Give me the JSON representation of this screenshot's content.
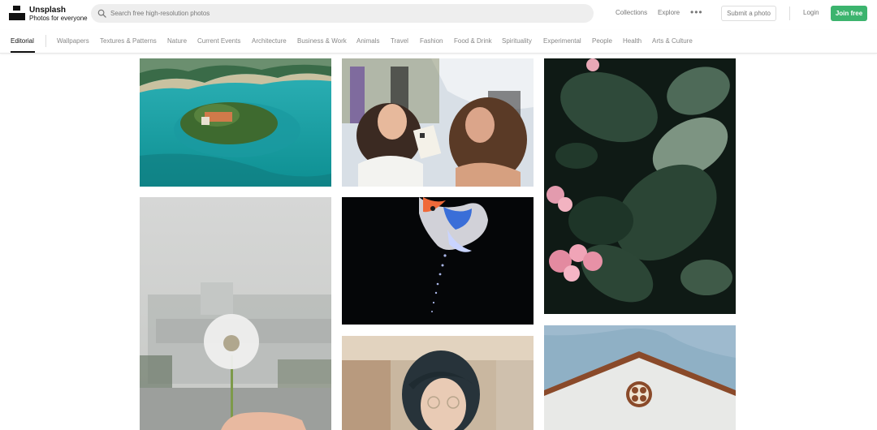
{
  "brand": {
    "name": "Unsplash",
    "tagline": "Photos for everyone"
  },
  "search": {
    "placeholder": "Search free high-resolution photos",
    "value": ""
  },
  "nav": {
    "collections": "Collections",
    "explore": "Explore",
    "more": "•••",
    "submit": "Submit a photo",
    "login": "Login",
    "join": "Join free"
  },
  "categories": [
    "Editorial",
    "Wallpapers",
    "Textures & Patterns",
    "Nature",
    "Current Events",
    "Architecture",
    "Business & Work",
    "Animals",
    "Travel",
    "Fashion",
    "Food & Drink",
    "Spirituality",
    "Experimental",
    "People",
    "Health",
    "Arts & Culture"
  ],
  "active_category": "Editorial",
  "colors": {
    "accent": "#3cb46e",
    "text": "#111111",
    "muted": "#777777"
  },
  "photos": [
    {
      "subject": "island in turquoise lake"
    },
    {
      "subject": "two women laughing at festival"
    },
    {
      "subject": "dark leaves with pink flowers"
    },
    {
      "subject": "hand holding dandelion"
    },
    {
      "subject": "colorful betta fish on black"
    },
    {
      "subject": "woman with short dark hair"
    },
    {
      "subject": "white roof gable with round window"
    }
  ]
}
